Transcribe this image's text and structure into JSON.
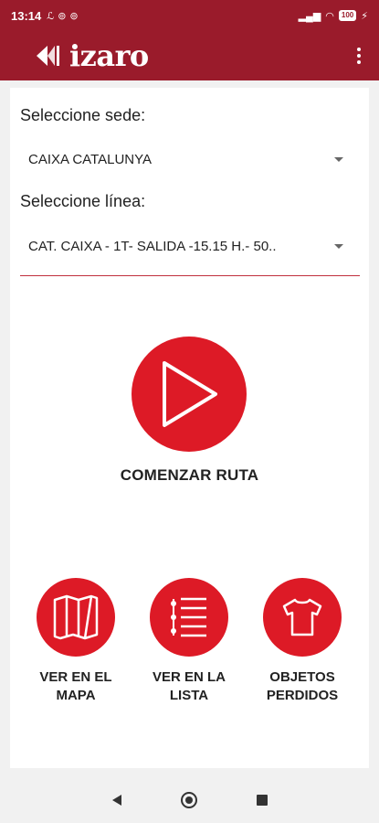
{
  "status_bar": {
    "time": "13:14",
    "battery": "100"
  },
  "app_bar": {
    "logo_text": "izaro"
  },
  "form": {
    "sede_label": "Seleccione sede:",
    "sede_value": "CAIXA CATALUNYA",
    "linea_label": "Seleccione línea:",
    "linea_value": "CAT. CAIXA - 1T- SALIDA -15.15 H.- 50.."
  },
  "start": {
    "label": "COMENZAR RUTA"
  },
  "actions": [
    {
      "label": "VER EN EL MAPA",
      "icon": "map-icon"
    },
    {
      "label": "VER EN LA LISTA",
      "icon": "list-icon"
    },
    {
      "label": "OBJETOS PERDIDOS",
      "icon": "tshirt-icon"
    }
  ],
  "colors": {
    "brand": "#9a1b2b",
    "accent": "#dd1a26"
  }
}
